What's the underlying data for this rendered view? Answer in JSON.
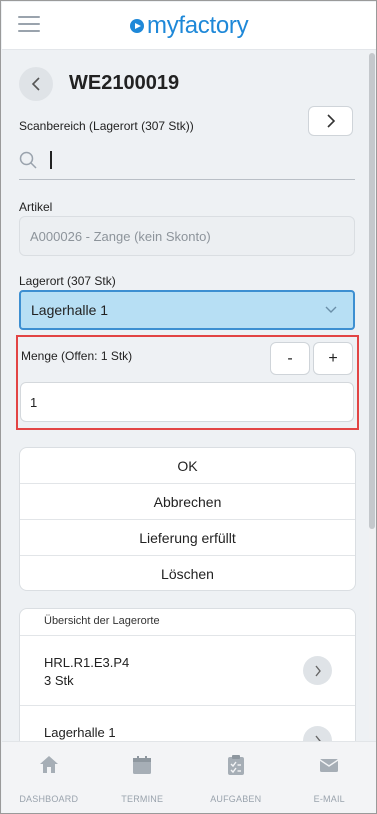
{
  "header": {
    "menu_icon": "hamburger-icon",
    "logo_text": "myfactory"
  },
  "page": {
    "title": "WE2100019",
    "back_icon": "chevron-left-icon",
    "next_icon": "chevron-right-icon"
  },
  "scan": {
    "label": "Scanbereich (Lagerort (307 Stk))",
    "value": ""
  },
  "article": {
    "label": "Artikel",
    "value": "A000026 - Zange (kein Skonto)"
  },
  "location": {
    "label": "Lagerort (307 Stk)",
    "selected": "Lagerhalle 1"
  },
  "quantity": {
    "label": "Menge (Offen: 1 Stk)",
    "minus": "-",
    "plus": "+",
    "value": "1"
  },
  "actions": {
    "ok": "OK",
    "cancel": "Abbrechen",
    "fulfilled": "Lieferung erfüllt",
    "delete": "Löschen"
  },
  "overview": {
    "header": "Übersicht der Lagerorte",
    "rows": [
      {
        "name": "HRL.R1.E3.P4",
        "qty": "3 Stk"
      },
      {
        "name": "Lagerhalle 1",
        "qty": ""
      }
    ]
  },
  "nav": {
    "dashboard": "DASHBOARD",
    "termine": "TERMINE",
    "aufgaben": "AUFGABEN",
    "email": "E-MAIL"
  },
  "colors": {
    "brand": "#1e88d8",
    "select_bg": "#b7dff4",
    "highlight": "#e24444"
  }
}
